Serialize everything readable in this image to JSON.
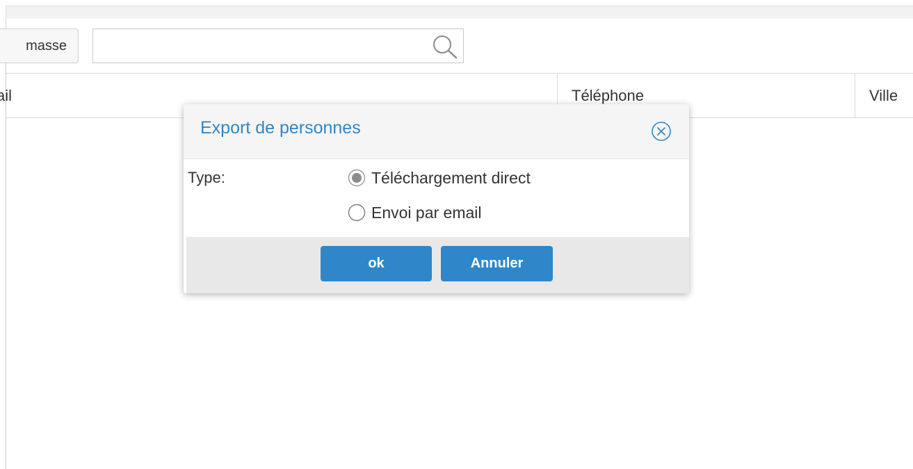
{
  "toolbar": {
    "masse_label": "masse",
    "search": {
      "value": "",
      "placeholder": ""
    }
  },
  "table": {
    "columns": [
      "ail",
      "Téléphone",
      "Ville"
    ]
  },
  "dialog": {
    "title": "Export de personnes",
    "type_label": "Type:",
    "options": [
      {
        "label": "Téléchargement direct",
        "selected": true
      },
      {
        "label": "Envoi par email",
        "selected": false
      }
    ],
    "ok_label": "ok",
    "cancel_label": "Annuler"
  },
  "colors": {
    "accent": "#2f86c8",
    "footer_bg": "#e8e8e8",
    "header_bg": "#f5f5f5"
  },
  "icons": {
    "search": "search-icon",
    "close": "close-icon",
    "radio_selected": "radio-selected-icon",
    "radio_unselected": "radio-unselected-icon"
  }
}
